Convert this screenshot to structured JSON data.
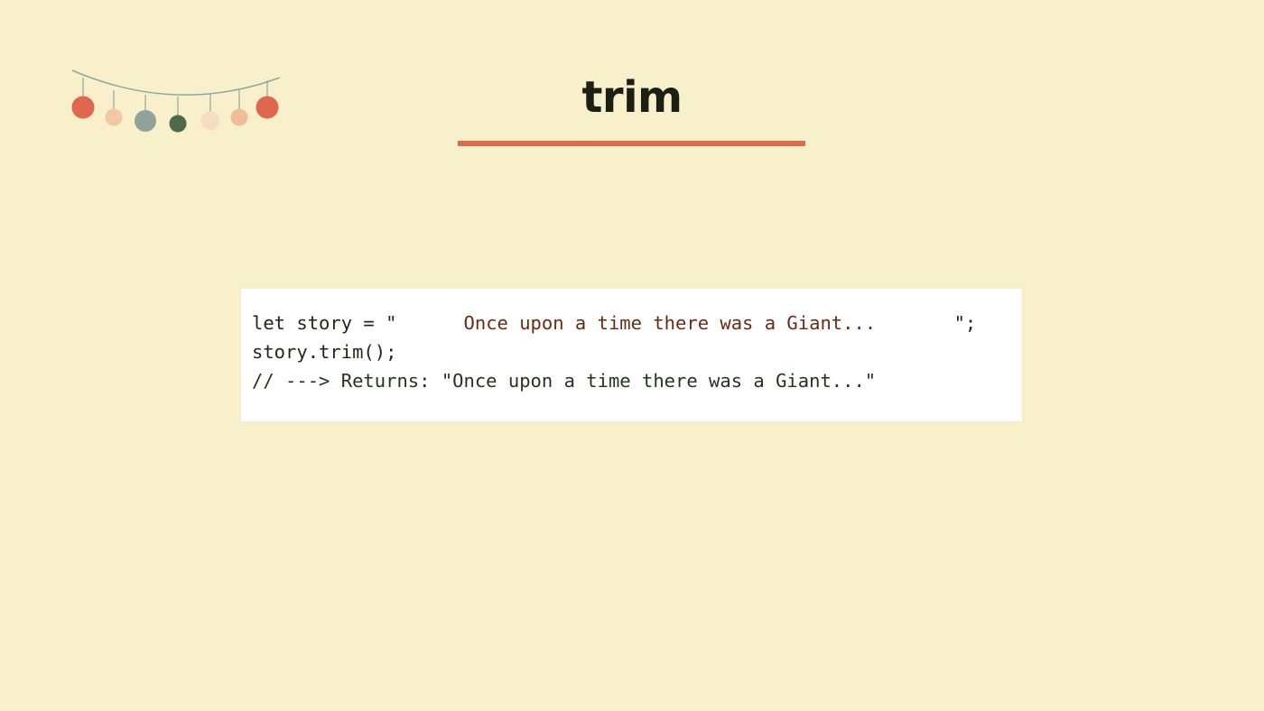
{
  "slide": {
    "title": "trim"
  },
  "code": {
    "line1": {
      "prefix": "let story = \"",
      "string_body": "      Once upon a time there was a Giant...       ",
      "suffix": "\";"
    },
    "line2": "story.trim();",
    "line3": "// ---> Returns: \"Once upon a time there was a Giant...\""
  },
  "garland": {
    "icon": "garland-ornaments-icon",
    "colors": [
      "#e0664e",
      "#f2c7a2",
      "#8fa39b",
      "#4d6a4a",
      "#f6dcc0",
      "#efbe98",
      "#e0664e"
    ]
  },
  "colors": {
    "background": "#f8efcb",
    "accent": "#dd6a4b",
    "title": "#1b1f14",
    "code_string": "#6b2a12"
  }
}
